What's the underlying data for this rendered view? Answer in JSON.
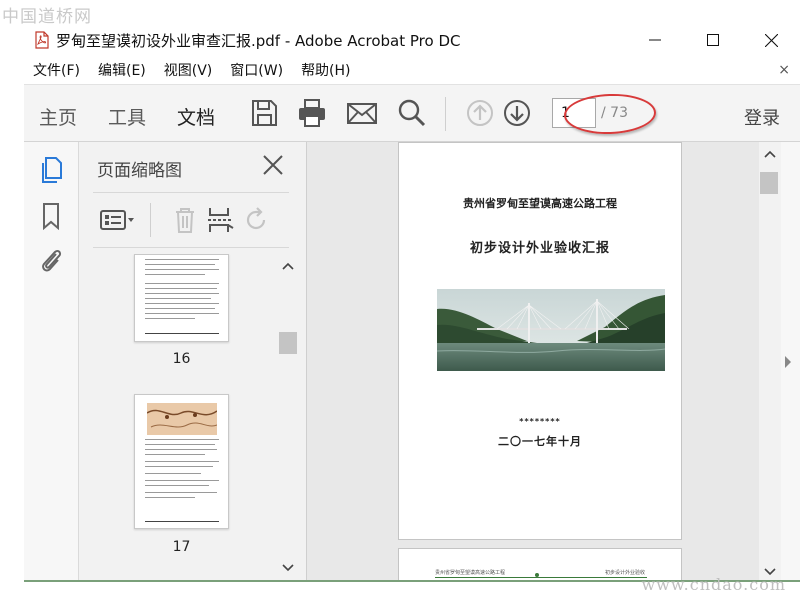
{
  "watermark": {
    "top": "中国道桥网",
    "bottom": "www.cndao.com"
  },
  "window": {
    "title": "罗甸至望谟初设外业审查汇报.pdf - Adobe Acrobat Pro DC",
    "controls": [
      "minimize",
      "maximize",
      "close"
    ]
  },
  "menu": {
    "items": [
      "文件(F)",
      "编辑(E)",
      "视图(V)",
      "窗口(W)",
      "帮助(H)"
    ],
    "close_doc": "×"
  },
  "toolbar": {
    "tabs": [
      {
        "label": "主页",
        "active": false
      },
      {
        "label": "工具",
        "active": false
      },
      {
        "label": "文档",
        "active": true
      }
    ],
    "icons": [
      "save-icon",
      "print-icon",
      "email-icon",
      "search-icon",
      "page-up-icon",
      "page-down-icon"
    ],
    "page_current": "1",
    "page_total": "/ 73",
    "login_label": "登录",
    "highlight_color": "#d83a3a"
  },
  "left_rail": {
    "icons": [
      "page-thumbnails-icon",
      "bookmark-icon",
      "attachment-icon"
    ],
    "accent": "#2a7ad8"
  },
  "thumb_panel": {
    "title": "页面缩略图",
    "tools": [
      "options-menu-icon",
      "delete-icon",
      "insert-page-icon",
      "rotate-icon"
    ],
    "pages": [
      {
        "label": "16"
      },
      {
        "label": "17"
      }
    ]
  },
  "document": {
    "page1": {
      "title1": "贵州省罗甸至望谟高速公路工程",
      "title2": "初步设计外业验收汇报",
      "stars": "********",
      "date": "二〇一七年十月"
    },
    "page2": {
      "header_left": "贵州省罗甸至望谟高速公路工程",
      "header_right": "初步设计外业验收"
    }
  }
}
